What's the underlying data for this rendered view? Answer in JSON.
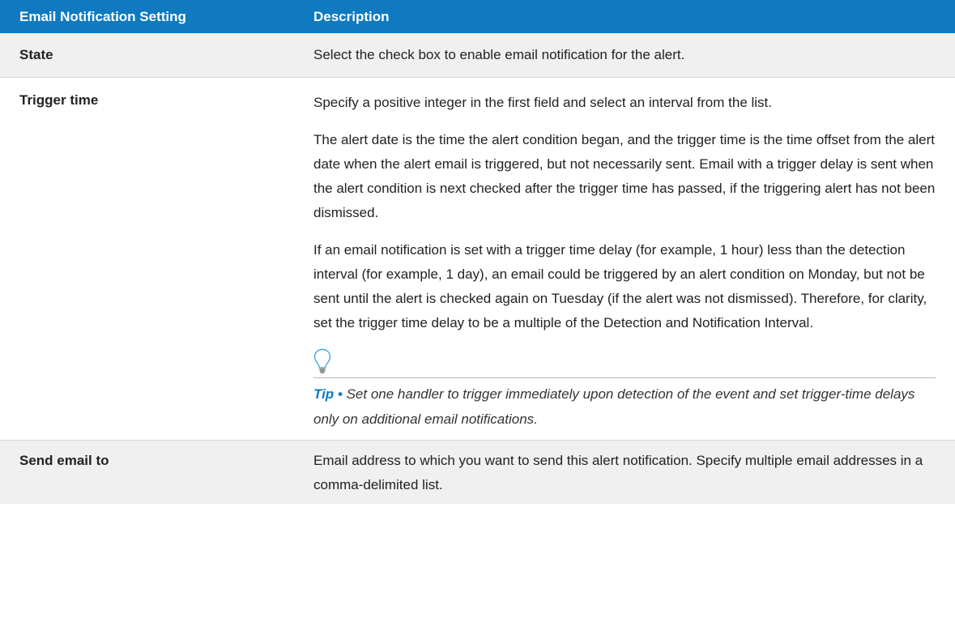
{
  "table": {
    "header": {
      "setting": "Email Notification Setting",
      "description": "Description"
    },
    "rows": [
      {
        "setting": "State",
        "paragraphs": [
          "Select the check box to enable email notification for the alert."
        ]
      },
      {
        "setting": "Trigger time",
        "paragraphs": [
          "Specify a positive integer in the first field and select an interval from the list.",
          "The alert date is the time the alert condition began, and the trigger time is the time offset from the alert date when the alert email is triggered, but not necessarily sent. Email with a trigger delay is sent when the alert condition is next checked after the trigger time has passed, if the triggering alert has not been dismissed.",
          "If an email notification is set with a trigger time delay (for example, 1 hour) less than the detection interval (for example, 1 day), an email could be triggered by an alert condition on Monday, but not be sent until the alert is checked again on Tuesday (if the alert was not dismissed). Therefore, for clarity, set the trigger time delay to be a multiple of the Detection and Notification Interval."
        ],
        "tip": {
          "icon": "lightbulb-icon",
          "label": "Tip •",
          "text": " Set one handler to trigger immediately upon detection of the event and set trigger-time delays only on additional email notifications."
        }
      },
      {
        "setting": "Send email to",
        "paragraphs": [
          "Email address to which you want to send this alert notification. Specify multiple email addresses in a comma-delimited list."
        ]
      }
    ]
  },
  "colors": {
    "header_bg": "#0f7ac0",
    "header_text": "#ffffff",
    "shaded_row": "#f0f0f0",
    "tip_label": "#0f7ac0",
    "bulb_outline": "#4aa8d8"
  }
}
